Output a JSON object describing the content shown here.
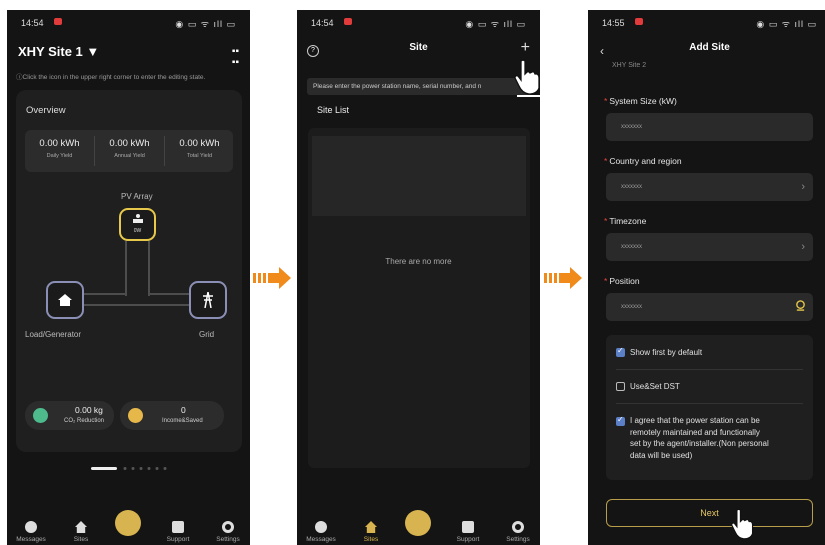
{
  "colors": {
    "accent": "#e6c84a",
    "orange_arrow": "#ef8a1b",
    "grid": "#8b8fb5",
    "checkbox": "#5b80c8",
    "required": "#e8453c"
  },
  "phone1": {
    "time": "14:54",
    "site_title": "XHY Site 1",
    "hint": "Click the icon in the upper right corner to enter the editing state.",
    "overview": "Overview",
    "stats": [
      {
        "value": "0.00 kWh",
        "label": "Daily Yield"
      },
      {
        "value": "0.00 kWh",
        "label": "Annual Yield"
      },
      {
        "value": "0.00 kWh",
        "label": "Total Yield"
      }
    ],
    "pv_label": "PV Array",
    "pv_power": "0W",
    "load_label": "Load/Generator",
    "grid_label": "Grid",
    "co2_value": "0.00 kg",
    "co2_label": "CO₂ Reduction",
    "income_value": "0",
    "income_label": "Income&Saved",
    "tabs": [
      "Messages",
      "Sites",
      "",
      "Support",
      "Settings"
    ]
  },
  "phone2": {
    "time": "14:54",
    "title": "Site",
    "search_placeholder": "Please enter the power station name, serial number, and n",
    "site_list": "Site List",
    "no_more": "There are no more",
    "tabs": [
      "Messages",
      "Sites",
      "",
      "Support",
      "Settings"
    ]
  },
  "phone3": {
    "time": "14:55",
    "title": "Add Site",
    "partial_value": "XHY Site 2",
    "fields": [
      {
        "label": "System Size (kW)",
        "value": "xxxxxxx"
      },
      {
        "label": "Country and region",
        "value": "xxxxxxx"
      },
      {
        "label": "Timezone",
        "value": "xxxxxxx"
      },
      {
        "label": "Position",
        "value": "xxxxxxx"
      }
    ],
    "show_first": "Show first by default",
    "dst": "Use&Set DST",
    "agree": [
      "I agree that the power station can be",
      "remotely maintained and functionally",
      "set by the agent/installer.(Non personal",
      "data will be used)"
    ],
    "next": "Next"
  }
}
